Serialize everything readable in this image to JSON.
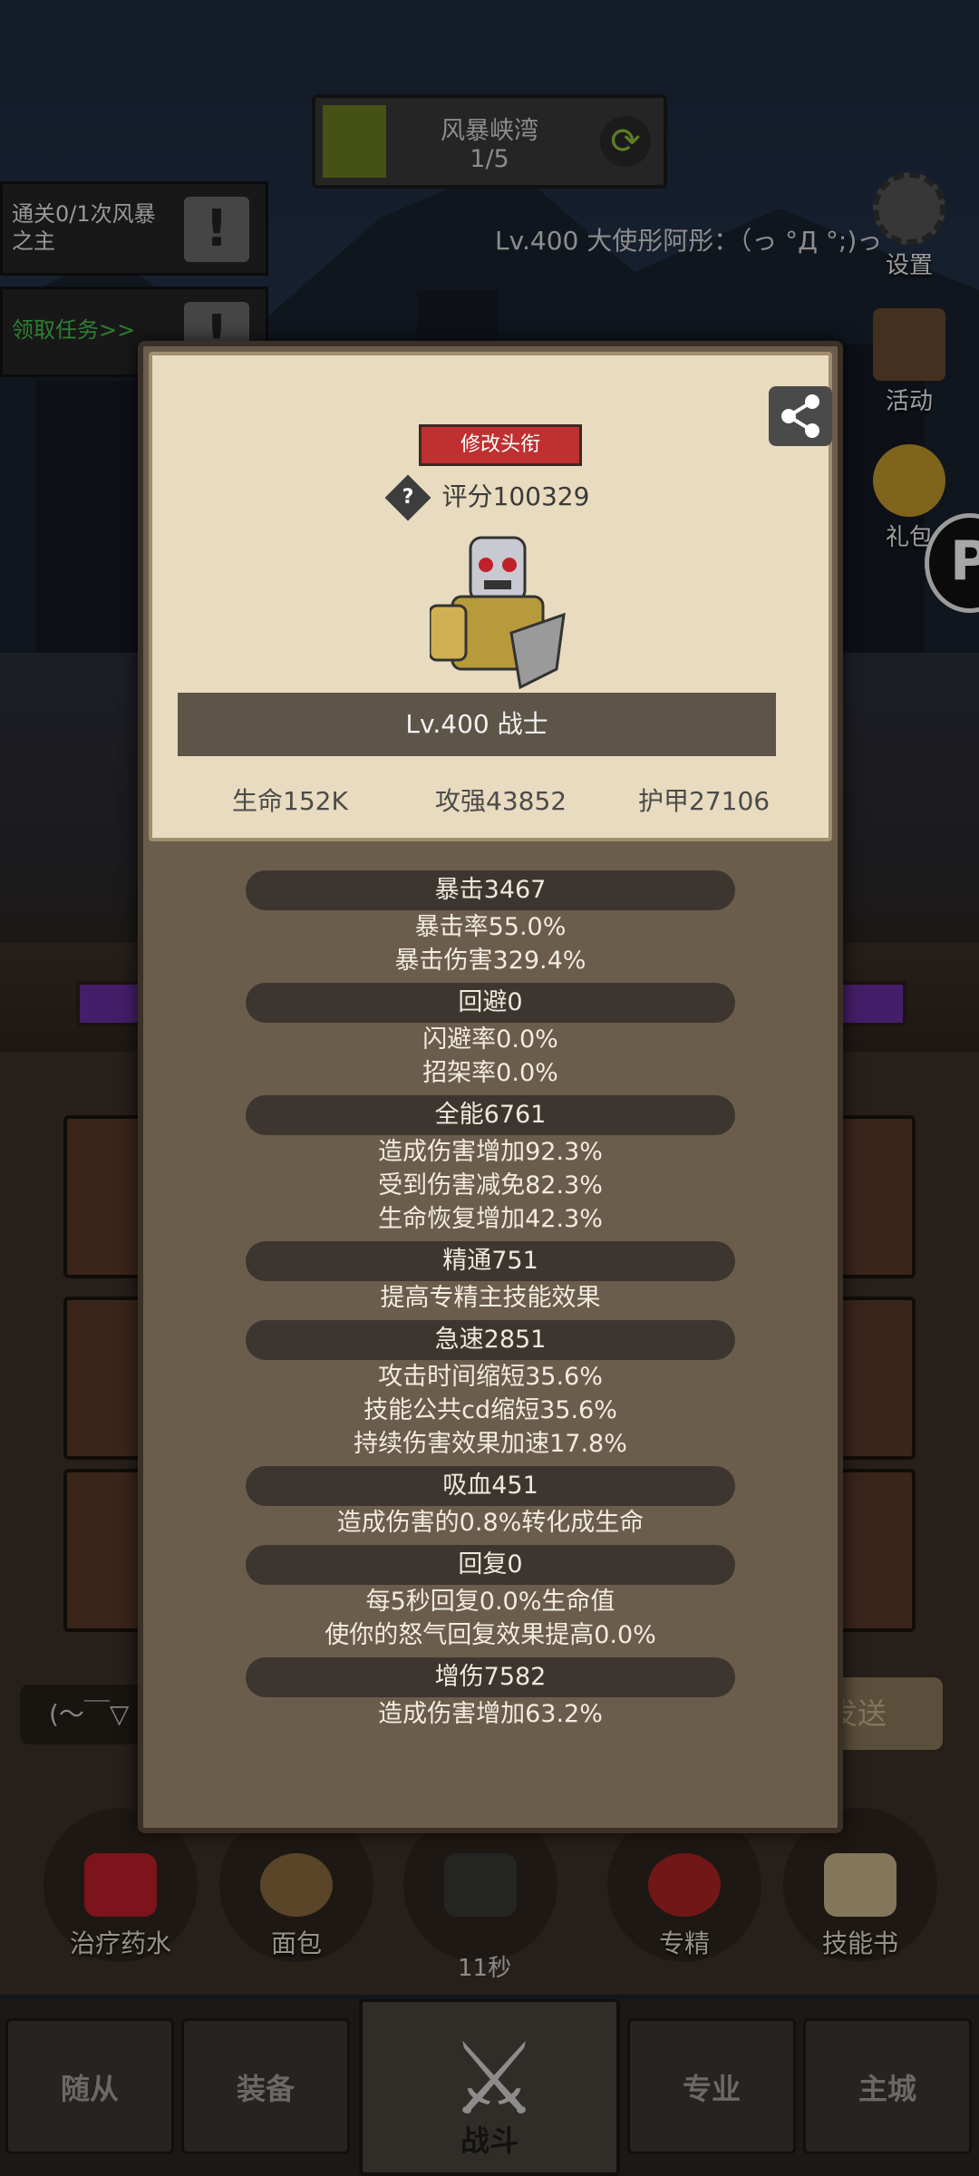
{
  "stage": {
    "name": "风暴峡湾",
    "progress": "1/5"
  },
  "quests": [
    {
      "text": "通关0/1次风暴之主"
    },
    {
      "text": "领取任务>>"
    }
  ],
  "player": {
    "line": "Lv.400 大使彤阿彤：（っ °Д °;)っ"
  },
  "side_menu": [
    {
      "label": "设置",
      "icon": "gear-icon"
    },
    {
      "label": "活动",
      "icon": "scroll-icon"
    },
    {
      "label": "礼包",
      "icon": "gift-icon"
    }
  ],
  "chat": {
    "placeholder": "(～￣▽",
    "send": "发送"
  },
  "consumables": [
    {
      "label": "治疗药水",
      "icon": "potion-icon"
    },
    {
      "label": "面包",
      "icon": "bread-icon"
    },
    {
      "label": "11秒",
      "icon": "chest-icon"
    },
    {
      "label": "专精",
      "icon": "specialization-icon"
    },
    {
      "label": "技能书",
      "icon": "skillbook-icon"
    }
  ],
  "nav": {
    "tabs": [
      "随从",
      "装备",
      "专业",
      "主城"
    ],
    "battle": "战斗"
  },
  "panel": {
    "title_button": "修改头衔",
    "score": "评分100329",
    "class_line": "Lv.400 战士",
    "base_stats": [
      "生命152K",
      "攻强43852",
      "护甲27106"
    ],
    "stats": [
      {
        "header": "暴击3467",
        "lines": [
          "暴击率55.0%",
          "暴击伤害329.4%"
        ]
      },
      {
        "header": "回避0",
        "lines": [
          "闪避率0.0%",
          "招架率0.0%"
        ]
      },
      {
        "header": "全能6761",
        "lines": [
          "造成伤害增加92.3%",
          "受到伤害减免82.3%",
          "生命恢复增加42.3%"
        ]
      },
      {
        "header": "精通751",
        "lines": [
          "提高专精主技能效果"
        ]
      },
      {
        "header": "急速2851",
        "lines": [
          "攻击时间缩短35.6%",
          "技能公共cd缩短35.6%",
          "持续伤害效果加速17.8%"
        ]
      },
      {
        "header": "吸血451",
        "lines": [
          "造成伤害的0.8%转化成生命"
        ]
      },
      {
        "header": "回复0",
        "lines": [
          "每5秒回复0.0%生命值",
          "使你的怒气回复效果提高0.0%"
        ]
      },
      {
        "header": "增伤7582",
        "lines": [
          "造成伤害增加63.2%"
        ]
      }
    ]
  },
  "colors": {
    "panel_bg": "#6b5d4c",
    "parchment": "#e8dbbf",
    "title_button": "#c03030",
    "stat_header": "#3d3630"
  }
}
